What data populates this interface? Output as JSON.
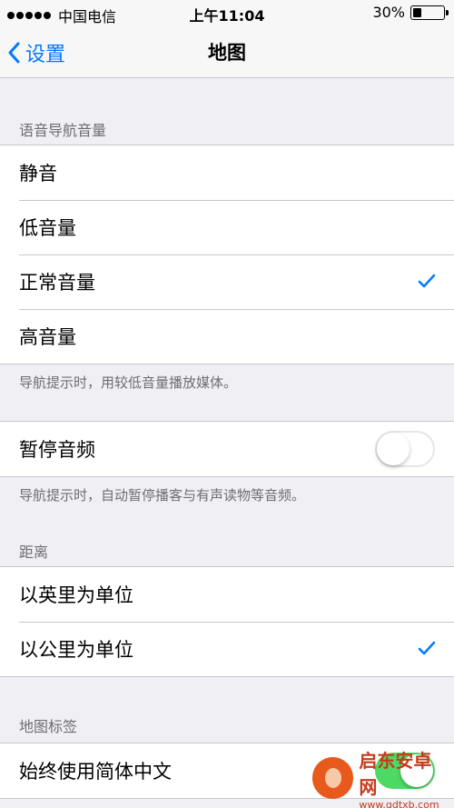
{
  "status_bar": {
    "carrier": "中国电信",
    "time": "上午11:04",
    "battery_percent": "30%",
    "battery_level": 0.3
  },
  "nav": {
    "back_label": "设置",
    "title": "地图"
  },
  "voice_volume": {
    "header": "语音导航音量",
    "options": [
      {
        "label": "静音",
        "checked": false
      },
      {
        "label": "低音量",
        "checked": false
      },
      {
        "label": "正常音量",
        "checked": true
      },
      {
        "label": "高音量",
        "checked": false
      }
    ],
    "footer": "导航提示时，用较低音量播放媒体。"
  },
  "pause_audio": {
    "label": "暂停音频",
    "enabled": false,
    "footer": "导航提示时，自动暂停播客与有声读物等音频。"
  },
  "distance": {
    "header": "距离",
    "options": [
      {
        "label": "以英里为单位",
        "checked": false
      },
      {
        "label": "以公里为单位",
        "checked": true
      }
    ]
  },
  "map_labels": {
    "header": "地图标签",
    "label": "始终使用简体中文",
    "enabled": true
  },
  "watermark": {
    "name": "启东安卓网",
    "url": "www.qdtxb.com"
  },
  "colors": {
    "accent": "#007aff",
    "switch_on": "#4cd964",
    "background": "#efeff4"
  }
}
